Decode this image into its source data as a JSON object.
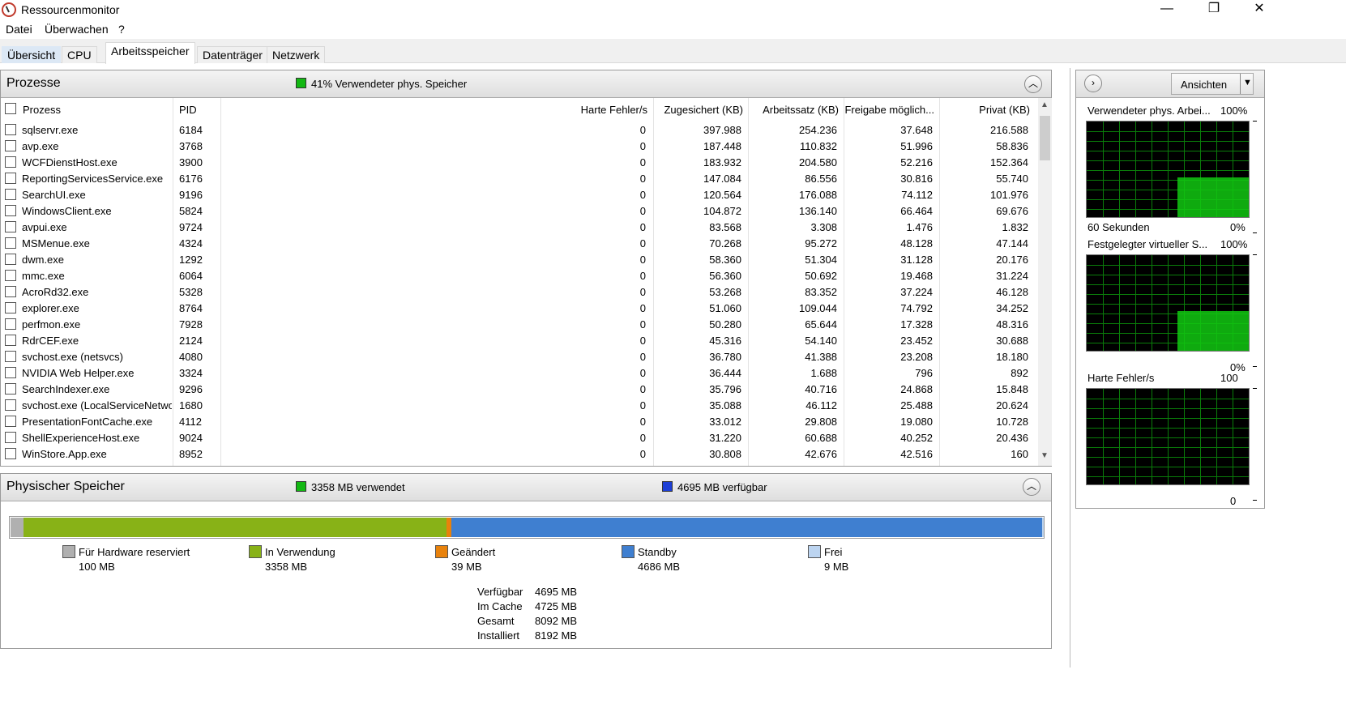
{
  "window": {
    "title": "Ressourcenmonitor",
    "minimize": "—",
    "maximize": "❐",
    "close": "✕"
  },
  "menu": [
    "Datei",
    "Überwachen",
    "?"
  ],
  "tabs": [
    "Übersicht",
    "CPU",
    "Arbeitsspeicher",
    "Datenträger",
    "Netzwerk"
  ],
  "active_tab": "Arbeitsspeicher",
  "processes": {
    "title": "Prozesse",
    "summary": "41% Verwendeter phys. Speicher",
    "summary_color": "#13b813",
    "columns": [
      "Prozess",
      "PID",
      "Harte Fehler/s",
      "Zugesichert (KB)",
      "Arbeitssatz (KB)",
      "Freigabe möglich...",
      "Privat (KB)"
    ],
    "rows": [
      [
        "sqlservr.exe",
        "6184",
        "0",
        "397.988",
        "254.236",
        "37.648",
        "216.588"
      ],
      [
        "avp.exe",
        "3768",
        "0",
        "187.448",
        "110.832",
        "51.996",
        "58.836"
      ],
      [
        "WCFDienstHost.exe",
        "3900",
        "0",
        "183.932",
        "204.580",
        "52.216",
        "152.364"
      ],
      [
        "ReportingServicesService.exe",
        "6176",
        "0",
        "147.084",
        "86.556",
        "30.816",
        "55.740"
      ],
      [
        "SearchUI.exe",
        "9196",
        "0",
        "120.564",
        "176.088",
        "74.112",
        "101.976"
      ],
      [
        "WindowsClient.exe",
        "5824",
        "0",
        "104.872",
        "136.140",
        "66.464",
        "69.676"
      ],
      [
        "avpui.exe",
        "9724",
        "0",
        "83.568",
        "3.308",
        "1.476",
        "1.832"
      ],
      [
        "MSMenue.exe",
        "4324",
        "0",
        "70.268",
        "95.272",
        "48.128",
        "47.144"
      ],
      [
        "dwm.exe",
        "1292",
        "0",
        "58.360",
        "51.304",
        "31.128",
        "20.176"
      ],
      [
        "mmc.exe",
        "6064",
        "0",
        "56.360",
        "50.692",
        "19.468",
        "31.224"
      ],
      [
        "AcroRd32.exe",
        "5328",
        "0",
        "53.268",
        "83.352",
        "37.224",
        "46.128"
      ],
      [
        "explorer.exe",
        "8764",
        "0",
        "51.060",
        "109.044",
        "74.792",
        "34.252"
      ],
      [
        "perfmon.exe",
        "7928",
        "0",
        "50.280",
        "65.644",
        "17.328",
        "48.316"
      ],
      [
        "RdrCEF.exe",
        "2124",
        "0",
        "45.316",
        "54.140",
        "23.452",
        "30.688"
      ],
      [
        "svchost.exe (netsvcs)",
        "4080",
        "0",
        "36.780",
        "41.388",
        "23.208",
        "18.180"
      ],
      [
        "NVIDIA Web Helper.exe",
        "3324",
        "0",
        "36.444",
        "1.688",
        "796",
        "892"
      ],
      [
        "SearchIndexer.exe",
        "9296",
        "0",
        "35.796",
        "40.716",
        "24.868",
        "15.848"
      ],
      [
        "svchost.exe (LocalServiceNetwo...",
        "1680",
        "0",
        "35.088",
        "46.112",
        "25.488",
        "20.624"
      ],
      [
        "PresentationFontCache.exe",
        "4112",
        "0",
        "33.012",
        "29.808",
        "19.080",
        "10.728"
      ],
      [
        "ShellExperienceHost.exe",
        "9024",
        "0",
        "31.220",
        "60.688",
        "40.252",
        "20.436"
      ],
      [
        "WinStore.App.exe",
        "8952",
        "0",
        "30.808",
        "42.676",
        "42.516",
        "160"
      ]
    ]
  },
  "physical": {
    "title": "Physischer Speicher",
    "used_summary": "3358 MB verwendet",
    "used_color": "#13b813",
    "avail_summary": "4695 MB verfügbar",
    "avail_color": "#1d3fd6",
    "legend": [
      {
        "label": "Für Hardware reserviert",
        "value": "100 MB",
        "color": "#b0b0b0",
        "mb": 100
      },
      {
        "label": "In Verwendung",
        "value": "3358 MB",
        "color": "#88b217",
        "mb": 3358
      },
      {
        "label": "Geändert",
        "value": "39 MB",
        "color": "#e8820c",
        "mb": 39
      },
      {
        "label": "Standby",
        "value": "4686 MB",
        "color": "#3f7fd0",
        "mb": 4686
      },
      {
        "label": "Frei",
        "value": "9 MB",
        "color": "#bcd4f0",
        "mb": 9
      }
    ],
    "stats": [
      {
        "label": "Verfügbar",
        "value": "4695 MB"
      },
      {
        "label": "Im Cache",
        "value": "4725 MB"
      },
      {
        "label": "Gesamt",
        "value": "8092 MB"
      },
      {
        "label": "Installiert",
        "value": "8192 MB"
      }
    ]
  },
  "side": {
    "views_button": "Ansichten",
    "graphs": [
      {
        "title": "Verwendeter phys. Arbei...",
        "max": "100%",
        "bottom_left": "60 Sekunden",
        "bottom_right": "0%",
        "level": 0.41
      },
      {
        "title": "Festgelegter virtueller S...",
        "max": "100%",
        "bottom_left": "",
        "bottom_right": "0%",
        "level": 0.41
      },
      {
        "title": "Harte Fehler/s",
        "max": "100",
        "bottom_left": "",
        "bottom_right": "0",
        "level": 0.0
      }
    ]
  }
}
